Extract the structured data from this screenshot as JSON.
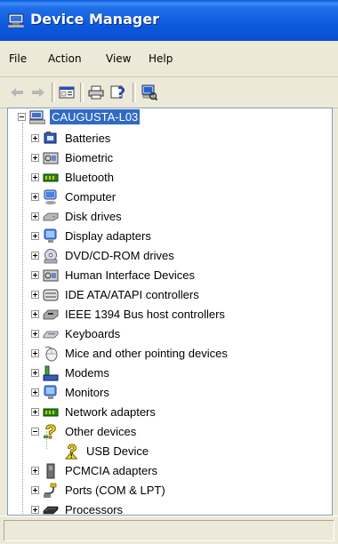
{
  "window": {
    "title": "Device Manager",
    "title_icon": "computer-monitor-icon"
  },
  "menu": [
    "File",
    "Action",
    "View",
    "Help"
  ],
  "toolbar": {
    "buttons": [
      "back-arrow-icon",
      "forward-arrow-icon",
      "properties-icon",
      "print-icon",
      "help-icon",
      "scan-hardware-icon"
    ]
  },
  "tree": {
    "root": {
      "label": "CAUGUSTA-L03",
      "icon": "computer-icon",
      "expanded": true,
      "selected": true
    },
    "nodes": [
      {
        "label": "Batteries",
        "icon": "battery-icon",
        "expanded": false
      },
      {
        "label": "Biometric",
        "icon": "biometric-icon",
        "expanded": false
      },
      {
        "label": "Bluetooth",
        "icon": "bluetooth-icon",
        "expanded": false
      },
      {
        "label": "Computer",
        "icon": "computer-icon",
        "expanded": false
      },
      {
        "label": "Disk drives",
        "icon": "disk-drive-icon",
        "expanded": false
      },
      {
        "label": "Display adapters",
        "icon": "display-adapter-icon",
        "expanded": false
      },
      {
        "label": "DVD/CD-ROM drives",
        "icon": "dvd-drive-icon",
        "expanded": false
      },
      {
        "label": "Human Interface Devices",
        "icon": "hid-icon",
        "expanded": false
      },
      {
        "label": "IDE ATA/ATAPI controllers",
        "icon": "ide-controller-icon",
        "expanded": false
      },
      {
        "label": "IEEE 1394 Bus host controllers",
        "icon": "ieee1394-icon",
        "expanded": false
      },
      {
        "label": "Keyboards",
        "icon": "keyboard-icon",
        "expanded": false
      },
      {
        "label": "Mice and other pointing devices",
        "icon": "mouse-icon",
        "expanded": false
      },
      {
        "label": "Modems",
        "icon": "modem-icon",
        "expanded": false
      },
      {
        "label": "Monitors",
        "icon": "monitor-icon",
        "expanded": false
      },
      {
        "label": "Network adapters",
        "icon": "network-adapter-icon",
        "expanded": false
      },
      {
        "label": "Other devices",
        "icon": "unknown-device-icon",
        "expanded": true,
        "children": [
          {
            "label": "USB Device",
            "icon": "warning-unknown-device-icon"
          }
        ]
      },
      {
        "label": "PCMCIA adapters",
        "icon": "pcmcia-icon",
        "expanded": false
      },
      {
        "label": "Ports (COM & LPT)",
        "icon": "port-icon",
        "expanded": false
      },
      {
        "label": "Processors",
        "icon": "processor-icon",
        "expanded": false
      }
    ]
  },
  "colors": {
    "titlebar": "#0a5ae0",
    "selection": "#316ac5",
    "chrome": "#ece9d8"
  }
}
